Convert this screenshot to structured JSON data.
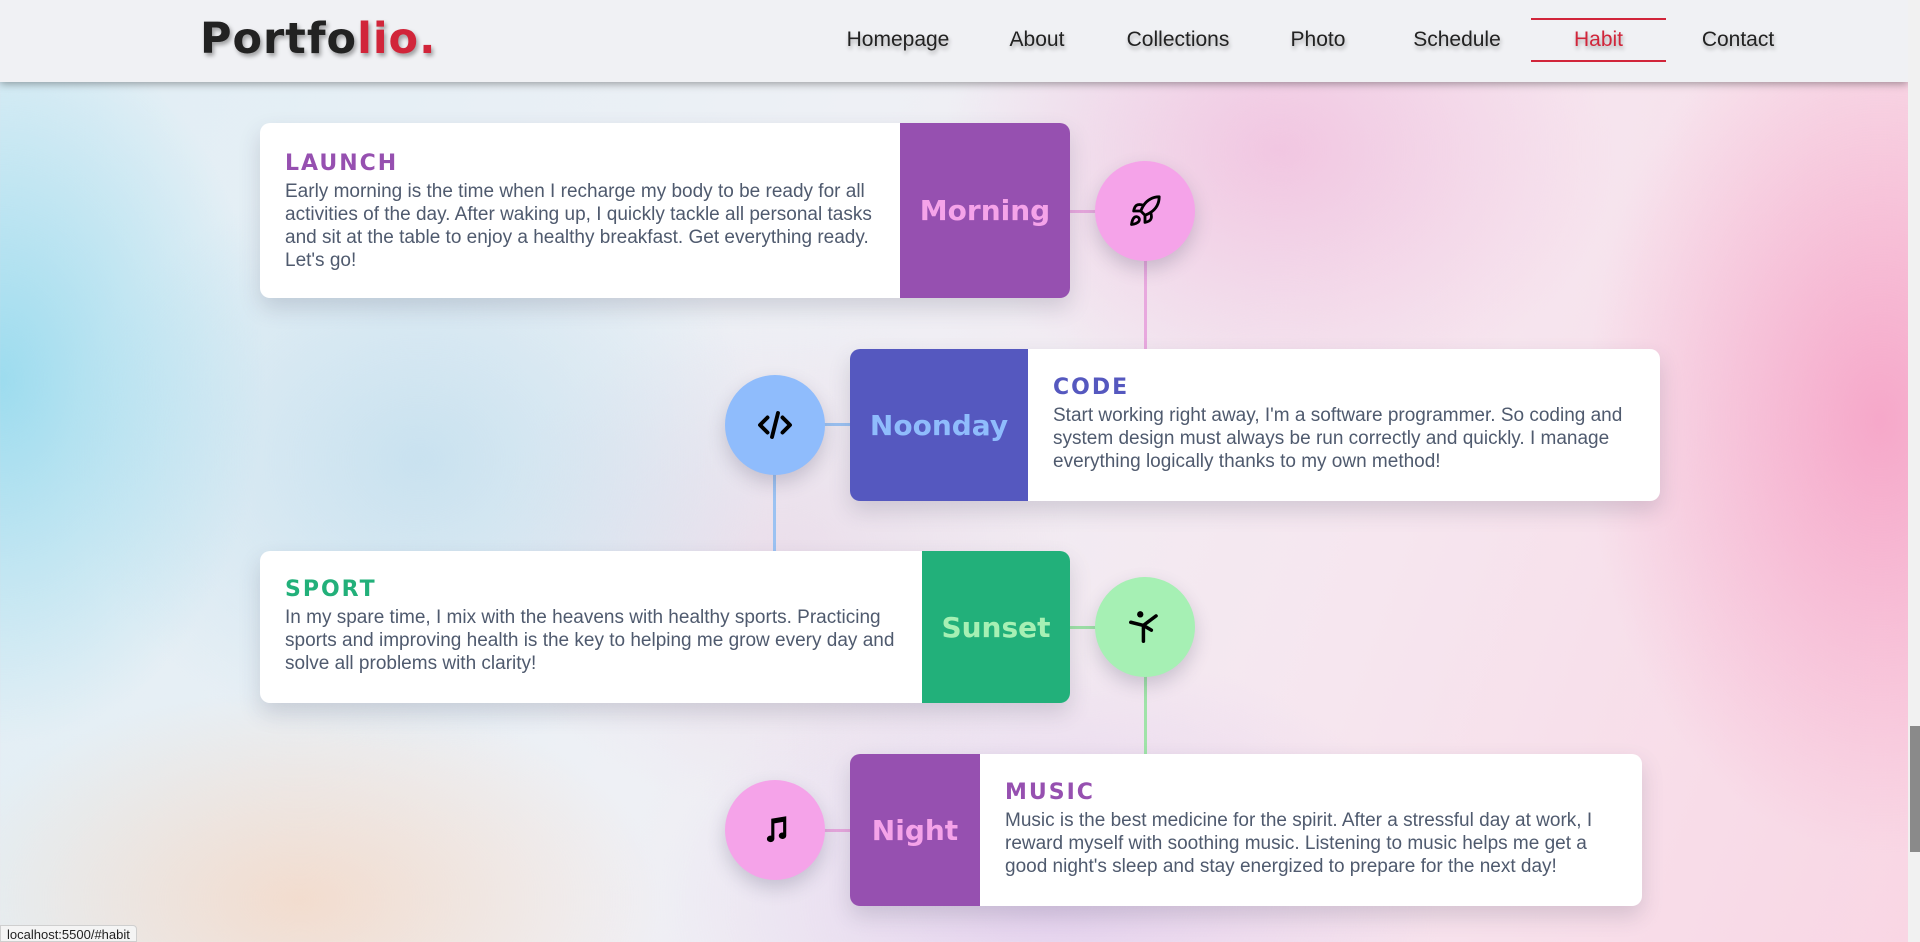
{
  "header": {
    "logo_main": "Portfo",
    "logo_accent": "lio.",
    "nav": [
      {
        "label": "Homepage"
      },
      {
        "label": "About"
      },
      {
        "label": "Collections"
      },
      {
        "label": "Photo"
      },
      {
        "label": "Schedule"
      },
      {
        "label": "Habit",
        "active": true
      },
      {
        "label": "Contact"
      }
    ]
  },
  "timeline": [
    {
      "title": "LAUNCH",
      "label": "Morning",
      "text": "Early morning is the time when I recharge my body to be ready for all activities of the day. After waking up, I quickly tackle all personal tasks and sit at the table to enjoy a healthy breakfast. Get everything ready. Let's go!",
      "icon": "rocket-icon",
      "colors": {
        "accent": "#9650b0",
        "label_text": "#f5a3e9",
        "circle": "#f5a3e9",
        "line": "#e8a8de"
      }
    },
    {
      "title": "CODE",
      "label": "Noonday",
      "text": "Start working right away, I'm a software programmer. So coding and system design must always be run correctly and quickly. I manage everything logically thanks to my own method!",
      "icon": "code-icon",
      "colors": {
        "accent": "#5558bf",
        "label_text": "#8fbcfc",
        "circle": "#8fbcfc",
        "line": "#9bc2f2"
      }
    },
    {
      "title": "SPORT",
      "label": "Sunset",
      "text": "In my spare time, I mix with the heavens with healthy sports. Practicing sports and improving health is the key to helping me grow every day and solve all problems with clarity!",
      "icon": "yoga-pose-icon",
      "colors": {
        "accent": "#22b07a",
        "label_text": "#a6f0b4",
        "circle": "#a6f0b4",
        "line": "#9fe3a8"
      }
    },
    {
      "title": "MUSIC",
      "label": "Night",
      "text": "Music is the best medicine for the spirit. After a stressful day at work, I reward myself with soothing music. Listening to music helps me get a good night's sleep and stay energized to prepare for the next day!",
      "icon": "music-note-icon",
      "colors": {
        "accent": "#9650b0",
        "label_text": "#f5a3e9",
        "circle": "#f5a3e9",
        "line": "#e8a8de"
      }
    }
  ],
  "status_url": "localhost:5500/#habit"
}
